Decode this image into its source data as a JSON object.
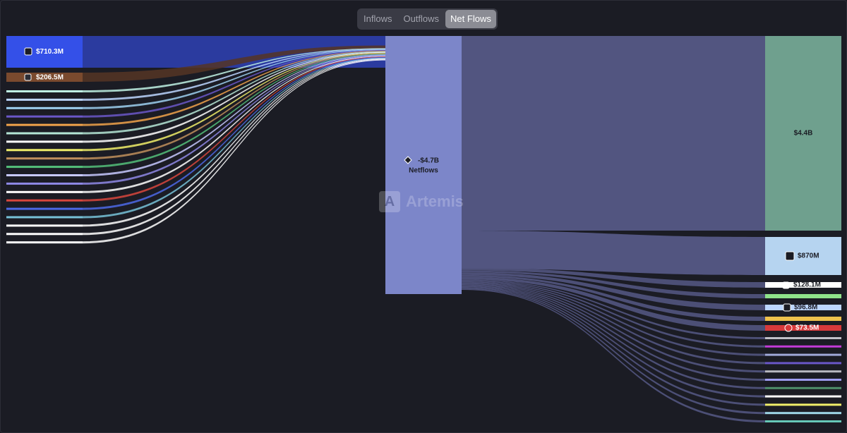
{
  "toggle": {
    "options": [
      "Inflows",
      "Outflows",
      "Net Flows"
    ],
    "active": "Net Flows"
  },
  "watermark": {
    "text": "Artemis"
  },
  "chart_data": {
    "type": "sankey",
    "center": {
      "label": "Netflows",
      "value": "-$4.7B",
      "icon": "ethereum-icon",
      "color": "#7c86c9"
    },
    "sources": [
      {
        "value": "$710.3M",
        "icon": "square-logo-icon",
        "color": "#3450e8",
        "link_color": "#2b3b9f"
      },
      {
        "value": "$206.5M",
        "icon": "chain-logo-icon",
        "color": "#7a4a2e",
        "link_color": "#553524"
      },
      {
        "color": "#bff2e4"
      },
      {
        "color": "#bcd6ff"
      },
      {
        "color": "#9ed0f0"
      },
      {
        "color": "#6a57c8"
      },
      {
        "color": "#f0a24a"
      },
      {
        "color": "#b5e6d6"
      },
      {
        "color": "#ffffff"
      },
      {
        "color": "#f1ef6a"
      },
      {
        "color": "#c08f5c"
      },
      {
        "color": "#54c07a"
      },
      {
        "color": "#c7c9ff"
      },
      {
        "color": "#8e88e6"
      },
      {
        "color": "#ffffff"
      },
      {
        "color": "#d8473d"
      },
      {
        "color": "#4c68e6"
      },
      {
        "color": "#77c2d8"
      },
      {
        "color": "#ffffff"
      },
      {
        "color": "#ffffff"
      },
      {
        "color": "#ffffff"
      }
    ],
    "targets": [
      {
        "value": "$4.4B",
        "color": "#6fa08e"
      },
      {
        "value": "$870M",
        "icon": "coin-logo-icon",
        "color": "#b6d4f0"
      },
      {
        "value": "$128.1M",
        "icon": "minus-logo-icon",
        "color": "#ffffff"
      },
      {
        "color": "#8fe38a"
      },
      {
        "value": "$96.8M",
        "icon": "slash-logo-icon",
        "color": "#bcd6ff"
      },
      {
        "color": "#efc24c"
      },
      {
        "value": "$73.5M",
        "icon": "red-circle-logo-icon",
        "color": "#d8393b"
      },
      {
        "color": "#c0c0c8"
      },
      {
        "color": "#c23bd6"
      },
      {
        "color": "#9fa8d8"
      },
      {
        "color": "#6a57c8"
      },
      {
        "color": "#b8b8c0"
      },
      {
        "color": "#9e9cf0"
      },
      {
        "color": "#4f8f6a"
      },
      {
        "color": "#ffffff"
      },
      {
        "color": "#f1ef6a"
      },
      {
        "color": "#9fd6e8"
      },
      {
        "color": "#66c7b8"
      }
    ]
  }
}
